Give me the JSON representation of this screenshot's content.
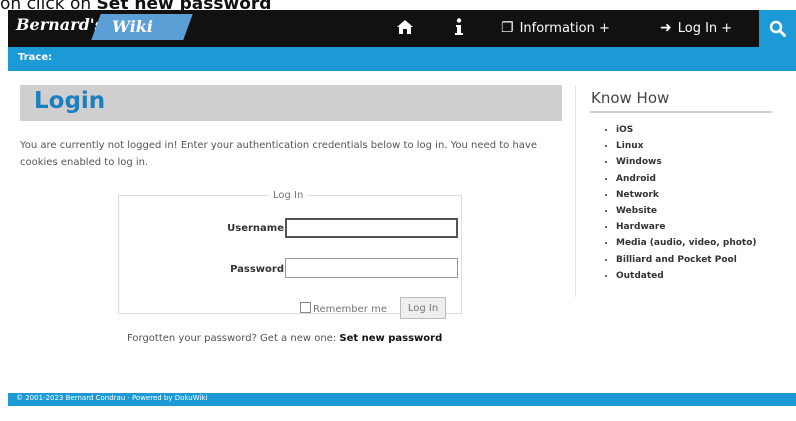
{
  "caption": {
    "prefix": "on click on ",
    "emphasis": "Set new password"
  },
  "navbar": {
    "logo_part1": "Bernard's",
    "logo_part2": "Wiki",
    "home_icon": "home-icon",
    "info_icon": "info-icon",
    "information_label": "Information +",
    "login_label": "Log In +",
    "search_icon": "search-icon",
    "accent": "#1c9ad6"
  },
  "trace": {
    "label": "Trace:"
  },
  "main": {
    "title": "Login",
    "intro": "You are currently not logged in! Enter your authentication credentials below to log in. You need to have cookies enabled to log in."
  },
  "login_form": {
    "legend": "Log In",
    "username_label": "Username",
    "username_value": "",
    "password_label": "Password",
    "password_value": "",
    "remember_label": "Remember me",
    "button_label": "Log In",
    "forgot_text": "Forgotten your password? Get a new one:",
    "forgot_link": "Set new password"
  },
  "sidebar": {
    "title": "Know How",
    "items": [
      "iOS",
      "Linux",
      "Windows",
      "Android",
      "Network",
      "Website",
      "Hardware",
      "Media (audio, video, photo)",
      "Billiard and Pocket Pool",
      "Outdated"
    ]
  },
  "footer": {
    "text": "© 2001-2023 Bernard Condrau · Powered by DokuWiki"
  }
}
